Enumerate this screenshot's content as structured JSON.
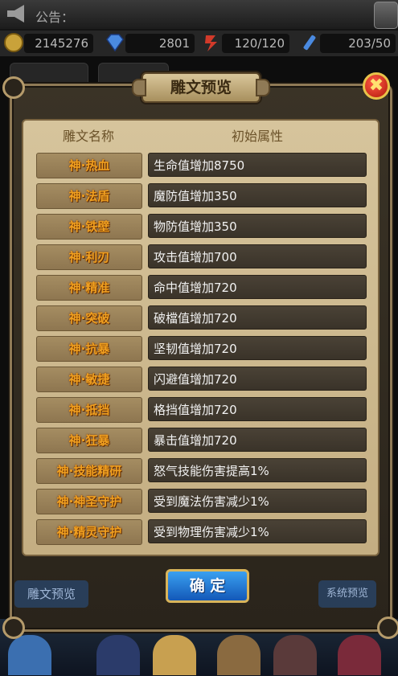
{
  "notice": {
    "label": "公告："
  },
  "resources": [
    {
      "icon": "gold-coin-icon",
      "value": "2145276"
    },
    {
      "icon": "diamond-icon",
      "value": "2801"
    },
    {
      "icon": "stamina-icon",
      "value": "120/120"
    },
    {
      "icon": "energy-icon",
      "value": "203/50"
    }
  ],
  "dialog": {
    "title": "雕文预览",
    "headers": {
      "name": "雕文名称",
      "attr": "初始属性"
    },
    "rows": [
      {
        "name": "神·热血",
        "attr": "生命值增加8750"
      },
      {
        "name": "神·法盾",
        "attr": "魔防值增加350"
      },
      {
        "name": "神·铁壁",
        "attr": "物防值增加350"
      },
      {
        "name": "神·利刃",
        "attr": "攻击值增加700"
      },
      {
        "name": "神·精准",
        "attr": "命中值增加720"
      },
      {
        "name": "神·突破",
        "attr": "破檔值增加720"
      },
      {
        "name": "神·抗暴",
        "attr": "坚韧值增加720"
      },
      {
        "name": "神·敏捷",
        "attr": "闪避值增加720"
      },
      {
        "name": "神·抵挡",
        "attr": "格挡值增加720"
      },
      {
        "name": "神·狂暴",
        "attr": "暴击值增加720"
      },
      {
        "name": "神·技能精研",
        "attr": "怒气技能伤害提高1%"
      },
      {
        "name": "神·神圣守护",
        "attr": "受到魔法伤害减少1%"
      },
      {
        "name": "神·精灵守护",
        "attr": "受到物理伤害减少1%"
      }
    ],
    "confirm_label": "确 定"
  },
  "background": {
    "left_button": "雕文预览",
    "right_button": "系统预览"
  },
  "colors": {
    "name_text": "#f0a020",
    "parchment": "#d6c49c",
    "confirm_blue": "#1f7ad6",
    "close_red": "#d02010"
  }
}
